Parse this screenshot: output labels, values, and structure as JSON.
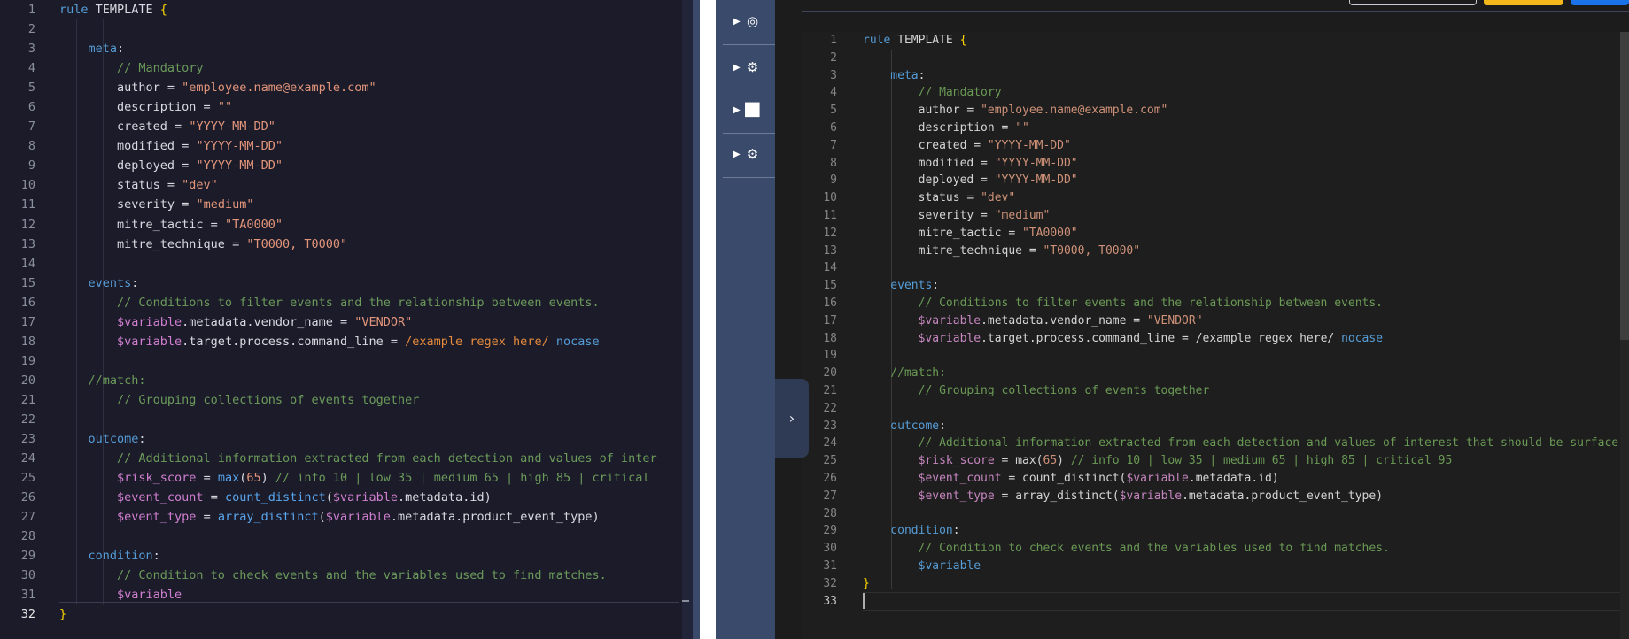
{
  "left_editor": {
    "active_line": 32,
    "lines": [
      [
        {
          "t": "rule ",
          "c": "kw"
        },
        {
          "t": "TEMPLATE ",
          "c": "pl"
        },
        {
          "t": "{",
          "c": "br"
        }
      ],
      [],
      [
        {
          "t": "    meta",
          "c": "kw"
        },
        {
          "t": ":",
          "c": "pl"
        }
      ],
      [
        {
          "t": "        // Mandatory",
          "c": "cmt"
        }
      ],
      [
        {
          "t": "        author = ",
          "c": "pl"
        },
        {
          "t": "\"employee.name@example.com\"",
          "c": "str"
        }
      ],
      [
        {
          "t": "        description = ",
          "c": "pl"
        },
        {
          "t": "\"\"",
          "c": "str"
        }
      ],
      [
        {
          "t": "        created = ",
          "c": "pl"
        },
        {
          "t": "\"YYYY-MM-DD\"",
          "c": "str"
        }
      ],
      [
        {
          "t": "        modified = ",
          "c": "pl"
        },
        {
          "t": "\"YYYY-MM-DD\"",
          "c": "str"
        }
      ],
      [
        {
          "t": "        deployed = ",
          "c": "pl"
        },
        {
          "t": "\"YYYY-MM-DD\"",
          "c": "str"
        }
      ],
      [
        {
          "t": "        status = ",
          "c": "pl"
        },
        {
          "t": "\"dev\"",
          "c": "str"
        }
      ],
      [
        {
          "t": "        severity = ",
          "c": "pl"
        },
        {
          "t": "\"medium\"",
          "c": "str"
        }
      ],
      [
        {
          "t": "        mitre_tactic = ",
          "c": "pl"
        },
        {
          "t": "\"TA0000\"",
          "c": "str"
        }
      ],
      [
        {
          "t": "        mitre_technique = ",
          "c": "pl"
        },
        {
          "t": "\"T0000, T0000\"",
          "c": "str"
        }
      ],
      [],
      [
        {
          "t": "    events",
          "c": "kw"
        },
        {
          "t": ":",
          "c": "pl"
        }
      ],
      [
        {
          "t": "        // Conditions to filter events and the relationship between events.",
          "c": "cmt"
        }
      ],
      [
        {
          "t": "        $variable",
          "c": "var"
        },
        {
          "t": ".metadata.vendor_name = ",
          "c": "pl"
        },
        {
          "t": "\"VENDOR\"",
          "c": "str"
        }
      ],
      [
        {
          "t": "        $variable",
          "c": "var"
        },
        {
          "t": ".target.process.command_line = ",
          "c": "pl"
        },
        {
          "t": "/example regex here/",
          "c": "rx"
        },
        {
          "t": " ",
          "c": "pl"
        },
        {
          "t": "nocase",
          "c": "kw"
        }
      ],
      [],
      [
        {
          "t": "    //match:",
          "c": "cmt"
        }
      ],
      [
        {
          "t": "        // Grouping collections of events together",
          "c": "cmt"
        }
      ],
      [],
      [
        {
          "t": "    outcome",
          "c": "kw"
        },
        {
          "t": ":",
          "c": "pl"
        }
      ],
      [
        {
          "t": "        // Additional information extracted from each detection and values of inter",
          "c": "cmt"
        }
      ],
      [
        {
          "t": "        $risk_score",
          "c": "var"
        },
        {
          "t": " = ",
          "c": "pl"
        },
        {
          "t": "max",
          "c": "fn"
        },
        {
          "t": "(",
          "c": "pl"
        },
        {
          "t": "65",
          "c": "str"
        },
        {
          "t": ") ",
          "c": "pl"
        },
        {
          "t": "// info 10 | low 35 | medium 65 | high 85 | critical",
          "c": "cmt"
        }
      ],
      [
        {
          "t": "        $event_count",
          "c": "var"
        },
        {
          "t": " = ",
          "c": "pl"
        },
        {
          "t": "count_distinct",
          "c": "fn"
        },
        {
          "t": "(",
          "c": "pl"
        },
        {
          "t": "$variable",
          "c": "var"
        },
        {
          "t": ".metadata.id)",
          "c": "pl"
        }
      ],
      [
        {
          "t": "        $event_type",
          "c": "var"
        },
        {
          "t": " = ",
          "c": "pl"
        },
        {
          "t": "array_distinct",
          "c": "fn"
        },
        {
          "t": "(",
          "c": "pl"
        },
        {
          "t": "$variable",
          "c": "var"
        },
        {
          "t": ".metadata.product_event_type)",
          "c": "pl"
        }
      ],
      [],
      [
        {
          "t": "    condition",
          "c": "kw"
        },
        {
          "t": ":",
          "c": "pl"
        }
      ],
      [
        {
          "t": "        // Condition to check events and the variables used to find matches.",
          "c": "cmt"
        }
      ],
      [
        {
          "t": "        $variable",
          "c": "var"
        }
      ],
      [
        {
          "t": "}",
          "c": "br"
        }
      ]
    ]
  },
  "sidenav": {
    "items": [
      {
        "icon": "radar-icon",
        "glyph": "◎"
      },
      {
        "icon": "gear-icon",
        "glyph": "⚙"
      },
      {
        "icon": "chart-icon",
        "glyph": "📈"
      },
      {
        "icon": "gears-icon",
        "glyph": "⚙"
      }
    ],
    "collapse_glyph": "›"
  },
  "right_editor": {
    "active_line": 33,
    "lines": [
      [
        {
          "t": "rule ",
          "c": "kw"
        },
        {
          "t": "TEMPLATE ",
          "c": "pl"
        },
        {
          "t": "{",
          "c": "br"
        }
      ],
      [],
      [
        {
          "t": "    meta",
          "c": "kw"
        },
        {
          "t": ":",
          "c": "pl"
        }
      ],
      [
        {
          "t": "        // Mandatory",
          "c": "cmt"
        }
      ],
      [
        {
          "t": "        author = ",
          "c": "pl"
        },
        {
          "t": "\"employee.name@example.com\"",
          "c": "str"
        }
      ],
      [
        {
          "t": "        description = ",
          "c": "pl"
        },
        {
          "t": "\"\"",
          "c": "str"
        }
      ],
      [
        {
          "t": "        created = ",
          "c": "pl"
        },
        {
          "t": "\"YYYY-MM-DD\"",
          "c": "str"
        }
      ],
      [
        {
          "t": "        modified = ",
          "c": "pl"
        },
        {
          "t": "\"YYYY-MM-DD\"",
          "c": "str"
        }
      ],
      [
        {
          "t": "        deployed = ",
          "c": "pl"
        },
        {
          "t": "\"YYYY-MM-DD\"",
          "c": "str"
        }
      ],
      [
        {
          "t": "        status = ",
          "c": "pl"
        },
        {
          "t": "\"dev\"",
          "c": "str"
        }
      ],
      [
        {
          "t": "        severity = ",
          "c": "pl"
        },
        {
          "t": "\"medium\"",
          "c": "str"
        }
      ],
      [
        {
          "t": "        mitre_tactic = ",
          "c": "pl"
        },
        {
          "t": "\"TA0000\"",
          "c": "str"
        }
      ],
      [
        {
          "t": "        mitre_technique = ",
          "c": "pl"
        },
        {
          "t": "\"T0000, T0000\"",
          "c": "str"
        }
      ],
      [],
      [
        {
          "t": "    events",
          "c": "kw"
        },
        {
          "t": ":",
          "c": "pl"
        }
      ],
      [
        {
          "t": "        // Conditions to filter events and the relationship between events.",
          "c": "cmt"
        }
      ],
      [
        {
          "t": "        $variable",
          "c": "var"
        },
        {
          "t": ".metadata.vendor_name = ",
          "c": "pl"
        },
        {
          "t": "\"VENDOR\"",
          "c": "str"
        }
      ],
      [
        {
          "t": "        $variable",
          "c": "var"
        },
        {
          "t": ".target.process.command_line = /example regex here/ ",
          "c": "pl"
        },
        {
          "t": "nocase",
          "c": "kw"
        }
      ],
      [],
      [
        {
          "t": "    //match:",
          "c": "cmt"
        }
      ],
      [
        {
          "t": "        // Grouping collections of events together",
          "c": "cmt"
        }
      ],
      [],
      [
        {
          "t": "    outcome",
          "c": "kw"
        },
        {
          "t": ":",
          "c": "pl"
        }
      ],
      [
        {
          "t": "        // Additional information extracted from each detection and values of interest that should be surface",
          "c": "cmt"
        }
      ],
      [
        {
          "t": "        $risk_score",
          "c": "var"
        },
        {
          "t": " = max(",
          "c": "pl"
        },
        {
          "t": "65",
          "c": "str"
        },
        {
          "t": ") ",
          "c": "pl"
        },
        {
          "t": "// info 10 | low 35 | medium 65 | high 85 | critical 95",
          "c": "cmt"
        }
      ],
      [
        {
          "t": "        $event_count",
          "c": "var"
        },
        {
          "t": " = count_distinct(",
          "c": "pl"
        },
        {
          "t": "$variable",
          "c": "var"
        },
        {
          "t": ".metadata.id)",
          "c": "pl"
        }
      ],
      [
        {
          "t": "        $event_type",
          "c": "var"
        },
        {
          "t": " = array_distinct(",
          "c": "pl"
        },
        {
          "t": "$variable",
          "c": "var"
        },
        {
          "t": ".metadata.product_event_type)",
          "c": "pl"
        }
      ],
      [],
      [
        {
          "t": "    condition",
          "c": "kw"
        },
        {
          "t": ":",
          "c": "pl"
        }
      ],
      [
        {
          "t": "        // Condition to check events and the variables used to find matches.",
          "c": "cmt"
        }
      ],
      [
        {
          "t": "        $variable",
          "c": "kw"
        }
      ],
      [
        {
          "t": "}",
          "c": "br"
        }
      ],
      []
    ]
  }
}
